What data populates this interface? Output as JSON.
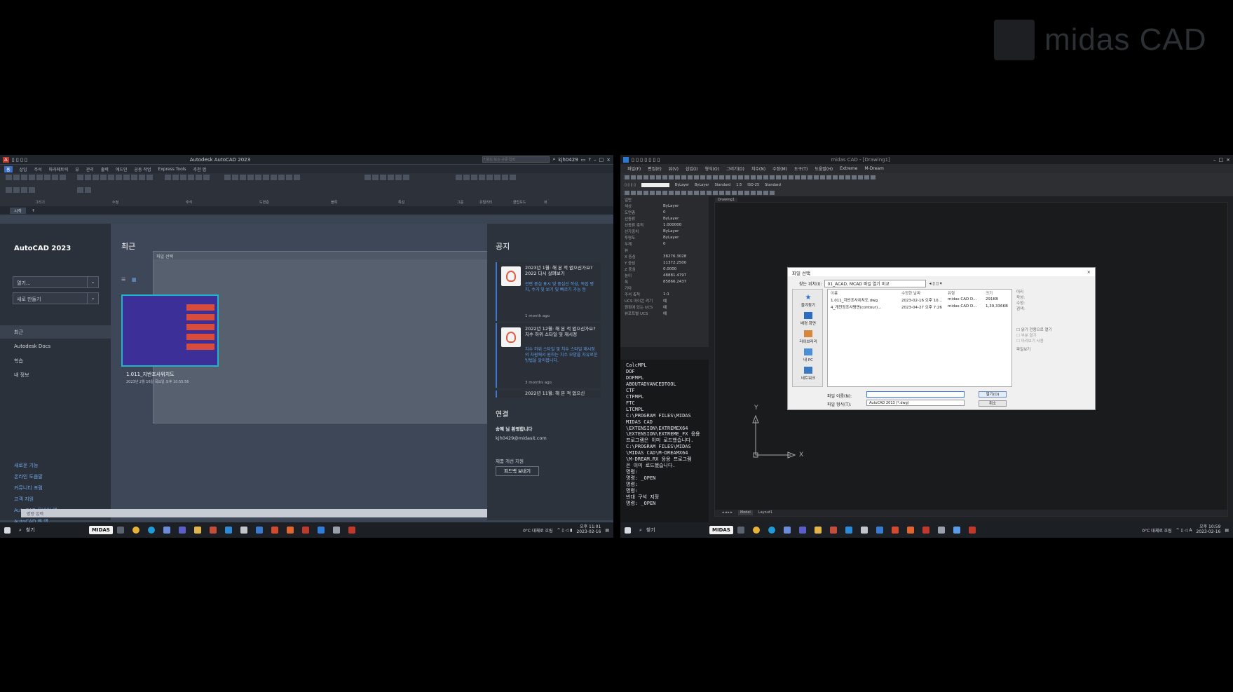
{
  "brand": {
    "logo_text": "midas CAD"
  },
  "left": {
    "titlebar": {
      "title": "Autodesk AutoCAD 2023",
      "user": "kjh0429",
      "search_placeholder": "키워드 또는 구문 입력"
    },
    "ribbon_tabs": [
      "홈",
      "삽입",
      "주석",
      "파라메트릭",
      "뷰",
      "관리",
      "출력",
      "애드인",
      "공동 작업",
      "Express Tools",
      "추천 앱"
    ],
    "ribbon_groups": [
      "그리기",
      "수정",
      "주석",
      "도면층",
      "블록",
      "특성",
      "그룹",
      "유틸리티",
      "클립보드",
      "뷰"
    ],
    "doc_tabs": [
      "시작",
      "+"
    ],
    "sidebar": {
      "product": "AutoCAD 2023",
      "open_dropdown": "열기...",
      "new_dropdown": "새로 만들기",
      "nav": [
        "최근",
        "Autodesk Docs",
        "학습",
        "내 정보"
      ],
      "links": [
        "새로운 기능",
        "온라인 도움말",
        "커뮤니티 포럼",
        "고객 지원",
        "AutoCAD 모바일 앱",
        "AutoCAD 웹 앱"
      ]
    },
    "recent": {
      "heading": "최근",
      "overlay_title": "파일 선택",
      "file_name": "1.011_지반조사위치도",
      "file_date": "2023년 2월 16일 목요일 오후 10:55:56"
    },
    "notices": {
      "heading": "공지",
      "cards": [
        {
          "title": "2023년 1월: 해 본 적 없으신가요? 2022 다시 살펴보기",
          "body": "관련 중심 표시 및 중심선 작성, 독립 평치, 수거 및 보기 및 빠르기 가능 등",
          "age": "1 month ago"
        },
        {
          "title": "2022년 12월: 해 본 적 없으신가요? 치수 하위 스타일 및 재시정",
          "body": "치수 하위 스타일 및 치수 스타일 재시정의 차원에서 원하는 치수 모양을 자유로운 방법을 알아봅니다.",
          "age": "3 months ago"
        },
        {
          "title": "2022년 11월: 해 본 적 없으신",
          "body": "",
          "age": ""
        }
      ]
    },
    "connect": {
      "heading": "연결",
      "welcome": "송혜 님 환영합니다",
      "email": "kjh0429@midasit.com",
      "product_improve": "제품 개선 지원",
      "feedback_btn": "피드백 보내기"
    },
    "cmd_placeholder": "명령 입력",
    "taskbar": {
      "search": "찾기",
      "tray_weather": "0°C 대체로 흐림",
      "time": "오후 11:01",
      "date": "2023-02-16"
    }
  },
  "right": {
    "titlebar": "midas CAD - [Drawing1]",
    "menu": [
      "파일(F)",
      "편집(E)",
      "뷰(V)",
      "삽입(I)",
      "형식(O)",
      "그리기(D)",
      "치수(N)",
      "수정(M)",
      "도구(T)",
      "도움말(H)",
      "Extreme",
      "M-Dream"
    ],
    "style_values": [
      "ByLayer",
      "ByLayer",
      "ByLayer",
      "Standard",
      "1:5",
      "ISO-25",
      "Standard"
    ],
    "doc_tab": "Drawing1",
    "properties": [
      {
        "k": "일반",
        "v": ""
      },
      {
        "k": "색상",
        "v": "ByLayer"
      },
      {
        "k": "도면층",
        "v": "0"
      },
      {
        "k": "선종류",
        "v": "ByLayer"
      },
      {
        "k": "선종류 축척",
        "v": "1.000000"
      },
      {
        "k": "선가중치",
        "v": "ByLayer"
      },
      {
        "k": "투명도",
        "v": "ByLayer"
      },
      {
        "k": "두께",
        "v": "0"
      },
      {
        "k": "뷰",
        "v": ""
      },
      {
        "k": "X 중심",
        "v": "38276.3028"
      },
      {
        "k": "Y 중심",
        "v": "11372.2500"
      },
      {
        "k": "Z 중심",
        "v": "0.0000"
      },
      {
        "k": "높이",
        "v": "48881.4797"
      },
      {
        "k": "폭",
        "v": "85866.2437"
      },
      {
        "k": "기타",
        "v": ""
      },
      {
        "k": "주석 축척",
        "v": "1:1"
      },
      {
        "k": "UCS 아이콘 켜기",
        "v": "예"
      },
      {
        "k": "원점에 있는 UCS",
        "v": "예"
      },
      {
        "k": "뷰포트별 UCS",
        "v": "예"
      }
    ],
    "cmd_history": "CalcMPL\nDOF\nDOFMPL\nABOUTADVANCEDTOOL\nCTF\nCTFMPL\nFTC\nLTCMPL\nC:\\PROGRAM FILES\\MIDAS\nMIDAS CAD\n\\EXTENSION\\EXTREMEX64\n\\EXTENSION\\EXTREME_FX 응용\n프로그램은 이미 로드했습니다.\nC:\\PROGRAM FILES\\MIDAS\n\\MIDAS CAD\\M-DREAMX64\n\\M-DREAM.RX 응용 프로그램\n은 이미 로드했습니다.\n명령:\n명령: _OPEN\n명령:\n명령:\n반대 구석 지정\n명령: _OPEN",
    "dialog": {
      "title": "파일 선택",
      "look_in_label": "찾는 위치(I):",
      "look_in_value": "01_ACAD, MCAD 파일 열기 비교",
      "places": [
        "즐겨찾기",
        "배경 화면",
        "라이브러리",
        "내 PC",
        "네트워크"
      ],
      "headers": [
        "이름",
        "수정한 날짜",
        "유형",
        "크기"
      ],
      "files": [
        {
          "name": "1.011_지반조사위치도.dwg",
          "date": "2023-02-16 오후 10...",
          "type": "midas CAD D...",
          "size": "291KB"
        },
        {
          "name": "4_개천정조사평면(contour)...",
          "date": "2023-04-27 오후 7:26",
          "type": "midas CAD D...",
          "size": "1,39,336KB"
        }
      ],
      "preview_labels": [
        "미리",
        "작성:",
        "수정:",
        "검색:"
      ],
      "checkbox_readonly": "읽기 전용으로 열기",
      "checkbox2": "부분 열기",
      "checkbox3": "미리보기 사용",
      "filename_label": "파일 이름(N):",
      "filetype_label": "파일 형식(T):",
      "filetype_value": "AutoCAD 2013 (*.dwg)",
      "open_btn": "열기(O)",
      "cancel_btn": "취소",
      "folder_link": "파일보기"
    },
    "ucs": {
      "x": "X",
      "y": "Y"
    },
    "status_tabs": [
      "Model",
      "Layout1"
    ],
    "taskbar": {
      "search": "찾기",
      "tray_weather": "0°C 대체로 흐림",
      "time": "오후 10:59",
      "date": "2023-02-16"
    }
  }
}
